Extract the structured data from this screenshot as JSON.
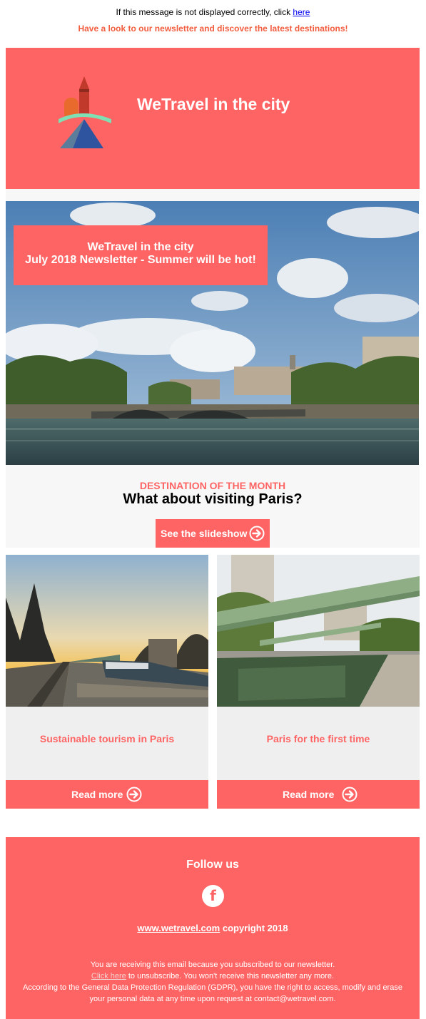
{
  "top_bar": {
    "notice_text": "If this message is not displayed correctly, click",
    "notice_link": "here",
    "tagline": "Have a look to our newsletter and discover the latest destinations!"
  },
  "header": {
    "title": "WeTravel in the city"
  },
  "hero": {
    "line1": "WeTravel in the city",
    "line2": "July 2018 Newsletter - Summer will be hot!"
  },
  "destination": {
    "label": "DESTINATION OF THE MONTH",
    "title": "What about visiting Paris?",
    "button_label": "See the slideshow"
  },
  "cards": [
    {
      "title": "Sustainable tourism in Paris",
      "button_label": "Read more"
    },
    {
      "title": "Paris for the first time",
      "button_label": "Read more"
    }
  ],
  "footer": {
    "follow_label": "Follow us",
    "facebook_glyph": "f",
    "site_link": "www.wetravel.com",
    "copyright": "copyright 2018",
    "legal_line1": "You are receiving this email because you subscribed to our newsletter.",
    "unsubscribe_link": "Click here",
    "legal_line2_rest": "to unsubscribe. You won't receive this newsletter any more.",
    "legal_line3": "According to the General Data Protection Regulation (GDPR), you have the right to access, modify and erase",
    "legal_line4": "your personal data at any time upon request at contact@wetravel.com."
  },
  "colors": {
    "brand": "#ff6464",
    "tagline": "#f25c3e",
    "panel": "#f7f7f7",
    "card": "#efefef"
  },
  "icons": {
    "arrow": "circle-arrow-right-icon",
    "facebook": "facebook-icon"
  }
}
